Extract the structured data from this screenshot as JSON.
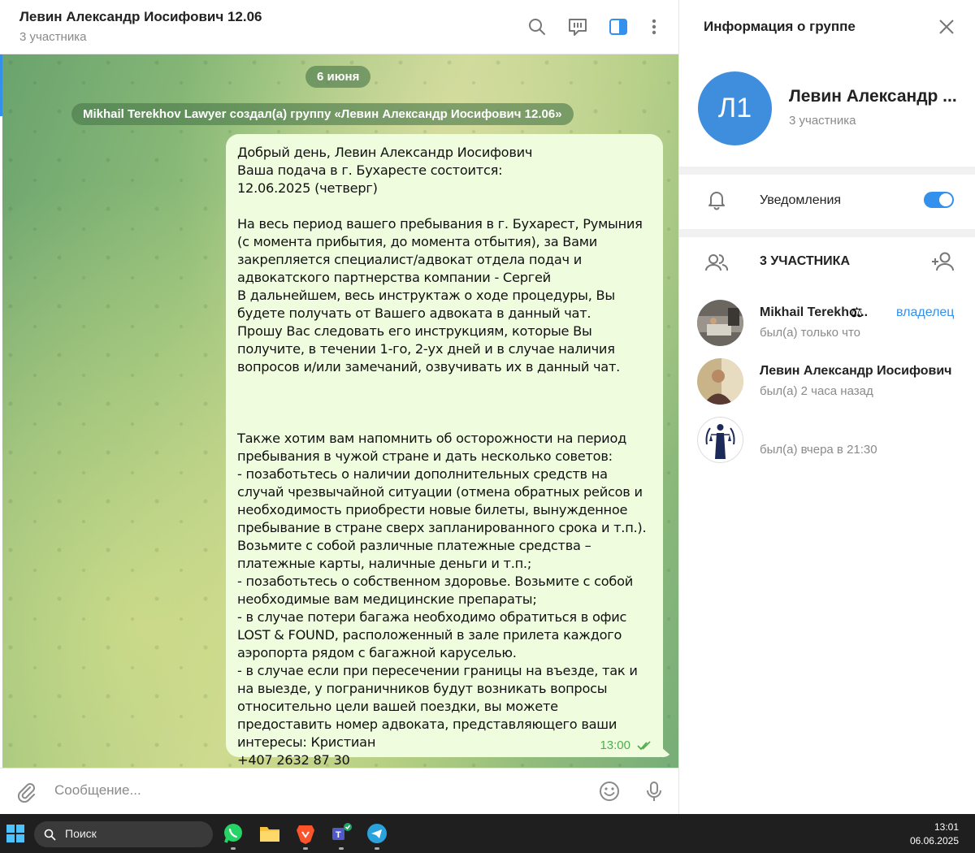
{
  "chat": {
    "title": "Левин Александр Иосифович 12.06",
    "subtitle": "3 участника",
    "date_pill": "6 июня",
    "service_message": "Mikhail Terekhov Lawyer создал(а) группу «Левин Александр Иосифович 12.06»",
    "message": {
      "text": "Добрый день, Левин Александр Иосифович\nВаша подача в г. Бухаресте состоится:\n12.06.2025 (четверг)\n\nНа весь период вашего пребывания в г. Бухарест, Румыния (с момента прибытия, до момента отбытия), за Вами закрепляется специалист/адвокат отдела подач и адвокатского партнерства компании - Сергей\nВ дальнейшем, весь инструктаж о ходе процедуры, Вы будете получать от Вашего адвоката в данный чат.\nПрошу Вас следовать его инструкциям, которые Вы получите, в течении 1-го, 2-ух дней и в случае наличия вопросов и/или замечаний, озвучивать их в данный чат.\n\n\n\nТакже хотим вам напомнить об осторожности на период пребывания в чужой стране и дать несколько советов:\n- позаботьтесь о наличии дополнительных средств на случай чрезвычайной ситуации (отмена обратных рейсов и необходимость приобрести новые билеты, вынужденное пребывание в стране сверх запланированного срока и т.п.). Возьмите с собой различные платежные средства – платежные карты, наличные деньги и т.п.;\n- позаботьтесь о собственном здоровье. Возьмите с собой необходимые вам медицинские препараты;\n- в случае потери багажа необходимо обратиться в офис LOST & FOUND, расположенный в зале прилета каждого аэропорта рядом с багажной каруселью.\n- в случае если при пересечении границы на въезде, так и на выезде, у пограничников будут возникать вопросы относительно цели вашей поездки, вы можете предоставить номер адвоката, представляющего ваши интересы: Кристиан\n+407 2632 87 30",
      "time": "13:00"
    },
    "composer_placeholder": "Сообщение..."
  },
  "info": {
    "title": "Информация о группе",
    "avatar_initials": "Л1",
    "group_name": "Левин Александр ...",
    "member_count": "3 участника",
    "notifications_label": "Уведомления",
    "notifications_on": true,
    "members_header": "3 УЧАСТНИКА",
    "members": [
      {
        "name": "Mikhail Terekho...",
        "role": "владелец",
        "status": "был(а) только что"
      },
      {
        "name": "Левин Александр Иосифович",
        "role": "",
        "status": "был(а) 2 часа назад"
      },
      {
        "name": "",
        "role": "",
        "status": "был(а) вчера в 21:30"
      }
    ]
  },
  "taskbar": {
    "search_label": "Поиск",
    "time": "13:01",
    "date": "06.06.2025"
  },
  "colors": {
    "accent": "#3390ec",
    "bubble": "#effdde",
    "time_green": "#4fae4e"
  },
  "icons": [
    "search-icon",
    "chat-bubble-icon",
    "sidebar-icon",
    "more-icon",
    "close-icon",
    "bell-icon",
    "people-icon",
    "add-user-icon",
    "paperclip-icon",
    "emoji-icon",
    "microphone-icon",
    "double-check-icon",
    "windows-start-icon",
    "whatsapp-icon",
    "folder-icon",
    "brave-icon",
    "teams-icon",
    "telegram-icon"
  ]
}
